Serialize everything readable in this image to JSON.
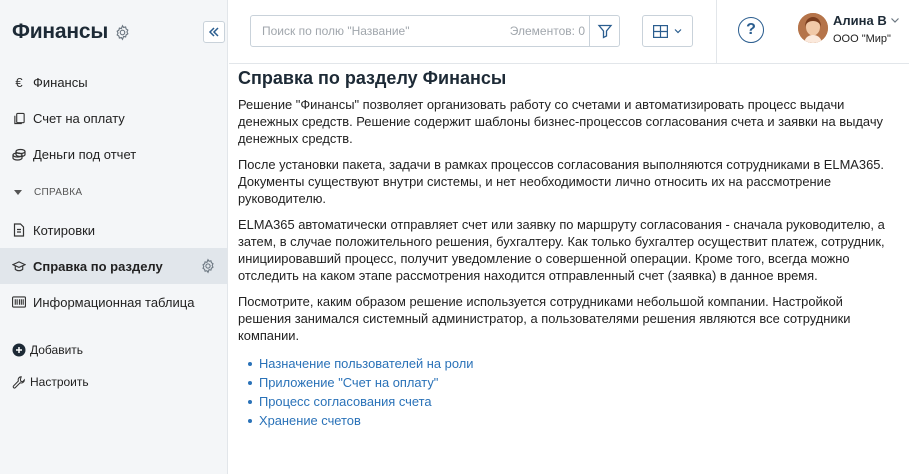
{
  "sidebar": {
    "title": "Финансы",
    "items": [
      {
        "label": "Финансы",
        "icon": "euro-icon"
      },
      {
        "label": "Счет на оплату",
        "icon": "document-copy-icon"
      },
      {
        "label": "Деньги под отчет",
        "icon": "coins-icon"
      }
    ],
    "section": {
      "label": "СПРАВКА"
    },
    "section_items": [
      {
        "label": "Котировки",
        "icon": "document-icon"
      },
      {
        "label": "Справка по разделу",
        "icon": "graduation-cap-icon",
        "active": true
      },
      {
        "label": "Информационная таблица",
        "icon": "barcode-icon"
      }
    ],
    "actions": {
      "add_label": "Добавить",
      "configure_label": "Настроить"
    }
  },
  "topbar": {
    "search": {
      "placeholder": "Поиск по полю \"Название\"",
      "count_label": "Элементов: 0"
    },
    "user": {
      "name": "Алина В",
      "org": "ООО \"Мир\""
    }
  },
  "content": {
    "title": "Справка по разделу Финансы",
    "paragraphs": [
      "Решение \"Финансы\" позволяет организовать работу со счетами и автоматизировать процесс выдачи денежных средств. Решение содержит шаблоны бизнес-процессов согласования счета и заявки на выдачу денежных средств.",
      "После установки пакета, задачи в рамках процессов согласования выполняются сотрудниками в ELMA365. Документы существуют внутри системы, и нет необходимости лично относить их на рассмотрение руководителю.",
      "ELMA365 автоматически отправляет счет или заявку по маршруту согласования - сначала руководителю, а затем, в случае положительного решения, бухгалтеру. Как только бухгалтер осуществит платеж, сотрудник, инициировавший процесс, получит уведомление о совершенной операции. Кроме того, всегда можно отследить на каком этапе рассмотрения находится отправленный счет (заявка) в данное время.",
      "Посмотрите, каким образом решение используется сотрудниками небольшой компании. Настройкой решения занимался системный администратор, а пользователями решения являются все сотрудники компании."
    ],
    "links": [
      "Назначение пользователей на роли",
      "Приложение \"Счет на оплату\"",
      "Процесс согласования счета",
      "Хранение счетов"
    ]
  },
  "colors": {
    "accent": "#2a72b8",
    "sidebar_bg": "#f4f6f8",
    "active_bg": "#e1e6eb",
    "title": "#1d2a36"
  }
}
